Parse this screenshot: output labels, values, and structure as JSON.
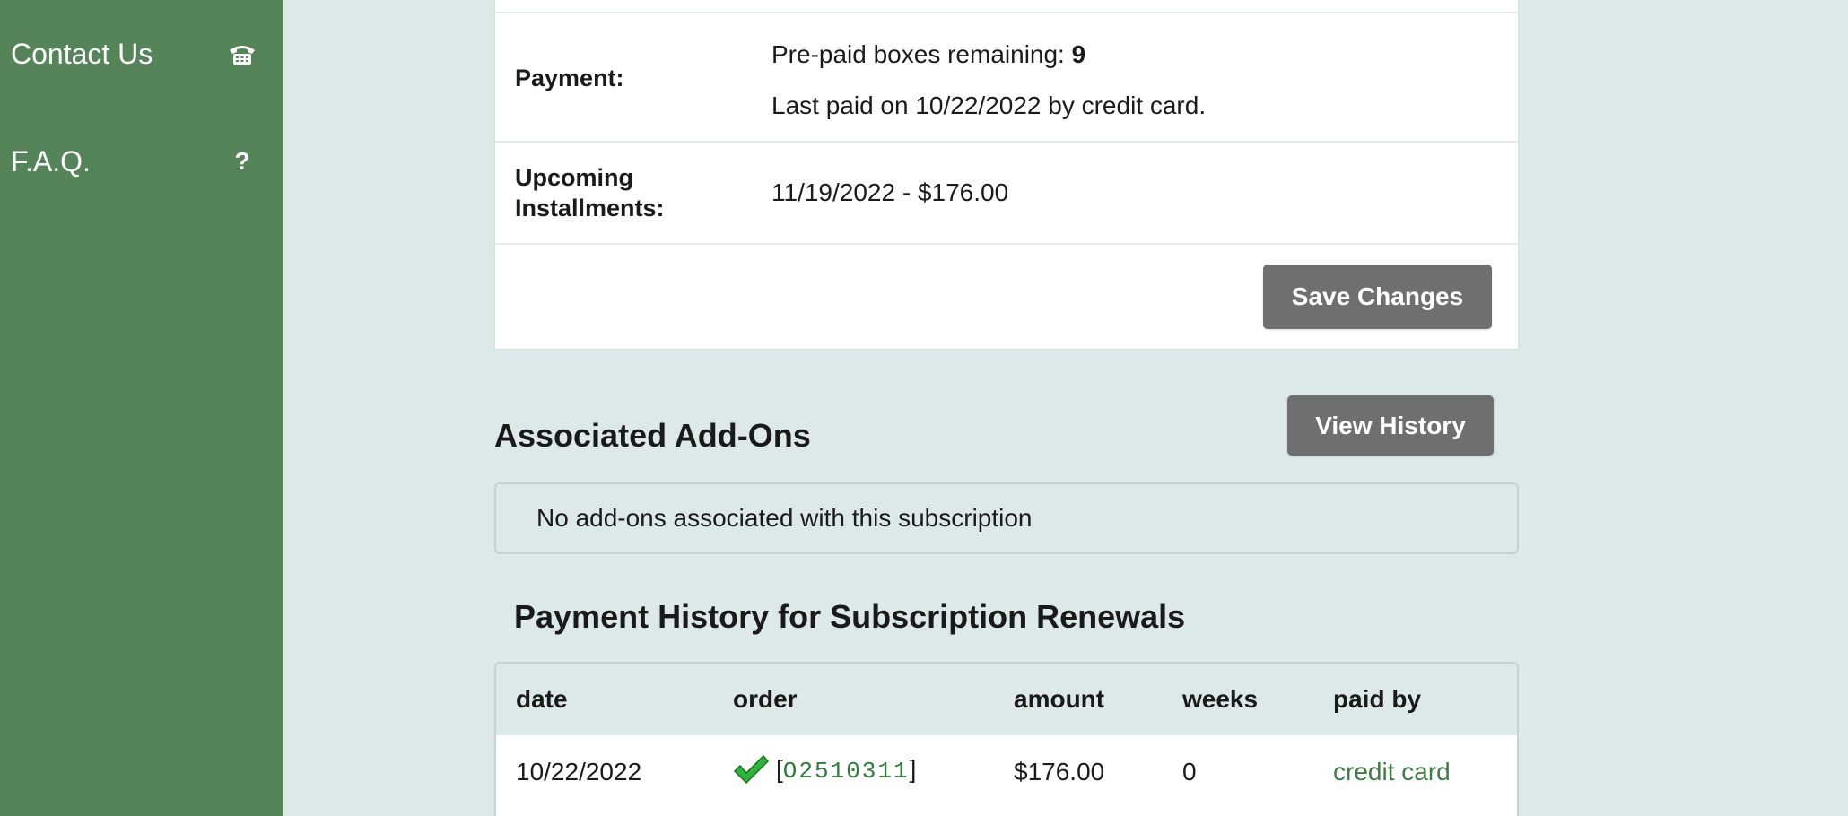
{
  "sidebar": {
    "items": [
      {
        "label": "Contact Us",
        "icon": "telephone-icon",
        "glyph": "☎"
      },
      {
        "label": "F.A.Q.",
        "icon": "question-icon",
        "glyph": "?"
      }
    ],
    "background": "#548457"
  },
  "subscription": {
    "payment_label": "Payment:",
    "prepaid_text": "Pre-paid boxes remaining: ",
    "prepaid_count": "9",
    "last_paid": "Last paid on 10/22/2022 by credit card.",
    "installments_label_1": "Upcoming",
    "installments_label_2": "Installments:",
    "installments_value": "11/19/2022 - $176.00",
    "save_label": "Save Changes"
  },
  "addons": {
    "title": "Associated Add-Ons",
    "history_label": "View History",
    "empty_text": "No add-ons associated with this subscription"
  },
  "payment_history": {
    "title": "Payment History for Subscription Renewals",
    "columns": [
      "date",
      "order",
      "amount",
      "weeks",
      "paid by"
    ],
    "rows": [
      {
        "date": "10/22/2022",
        "order_open": "[",
        "order": "O2510311",
        "order_close": "]",
        "amount": "$176.00",
        "weeks": "0",
        "paid_by": "credit card"
      }
    ]
  },
  "colors": {
    "accent_green": "#548457",
    "button_gray": "#6f6f6f",
    "link_green": "#3f7d45"
  }
}
